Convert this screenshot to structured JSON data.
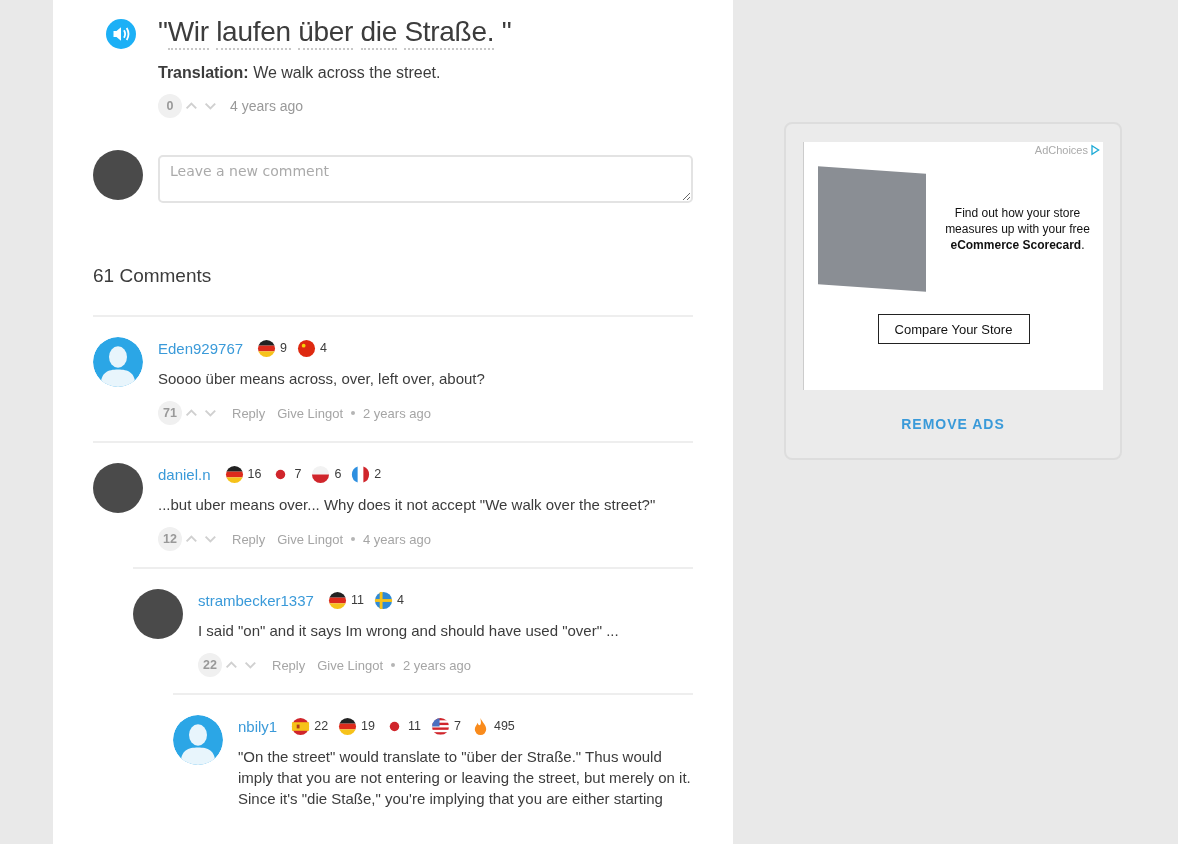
{
  "sentence": {
    "words": [
      "Wir",
      "laufen",
      "über",
      "die",
      "Straße."
    ],
    "open_quote": "\"",
    "close_quote": "\"",
    "translation_label": "Translation:",
    "translation": "We walk across the street.",
    "votes": "0",
    "time": "4 years ago"
  },
  "new_comment": {
    "placeholder": "Leave a new comment"
  },
  "comments_heading": "61 Comments",
  "comments": [
    {
      "user": "Eden929767",
      "avatar": {
        "kind": "default"
      },
      "flags": [
        {
          "kind": "de",
          "count": "9"
        },
        {
          "kind": "cn",
          "count": "4"
        }
      ],
      "text": "Soooo über means across, over, left over, about?",
      "votes": "71",
      "reply": "Reply",
      "lingot": "Give Lingot",
      "time": "2 years ago"
    },
    {
      "user": "daniel.n",
      "avatar": {
        "kind": "photo"
      },
      "flags": [
        {
          "kind": "de",
          "count": "16"
        },
        {
          "kind": "dot",
          "count": "7"
        },
        {
          "kind": "pl",
          "count": "6"
        },
        {
          "kind": "fr",
          "count": "2"
        }
      ],
      "text": "...but uber means over... Why does it not accept \"We walk over the street?\"",
      "votes": "12",
      "reply": "Reply",
      "lingot": "Give Lingot",
      "time": "4 years ago",
      "children": [
        {
          "user": "strambecker1337",
          "avatar": {
            "kind": "photo"
          },
          "flags": [
            {
              "kind": "de",
              "count": "11"
            },
            {
              "kind": "se",
              "count": "4"
            }
          ],
          "text": "I said \"on\" and it says Im wrong and should have used \"over\" ...",
          "votes": "22",
          "reply": "Reply",
          "lingot": "Give Lingot",
          "time": "2 years ago",
          "children": [
            {
              "user": "nbily1",
              "avatar": {
                "kind": "default"
              },
              "flags": [
                {
                  "kind": "es",
                  "count": "22"
                },
                {
                  "kind": "de",
                  "count": "19"
                },
                {
                  "kind": "dot",
                  "count": "11"
                },
                {
                  "kind": "us",
                  "count": "7"
                },
                {
                  "kind": "streak",
                  "count": "495"
                }
              ],
              "text": "\"On the street\" would translate to \"über der Straße.\" Thus would imply that you are not entering or leaving the street, but merely on it. Since it's \"die Staße,\" you're implying that you are either starting"
            }
          ]
        }
      ]
    }
  ],
  "ad": {
    "adchoices": "AdChoices",
    "text": "Find out how your store measures up with your free **eCommerce Scorecard**.",
    "button": "Compare Your Store",
    "remove": "REMOVE ADS"
  }
}
